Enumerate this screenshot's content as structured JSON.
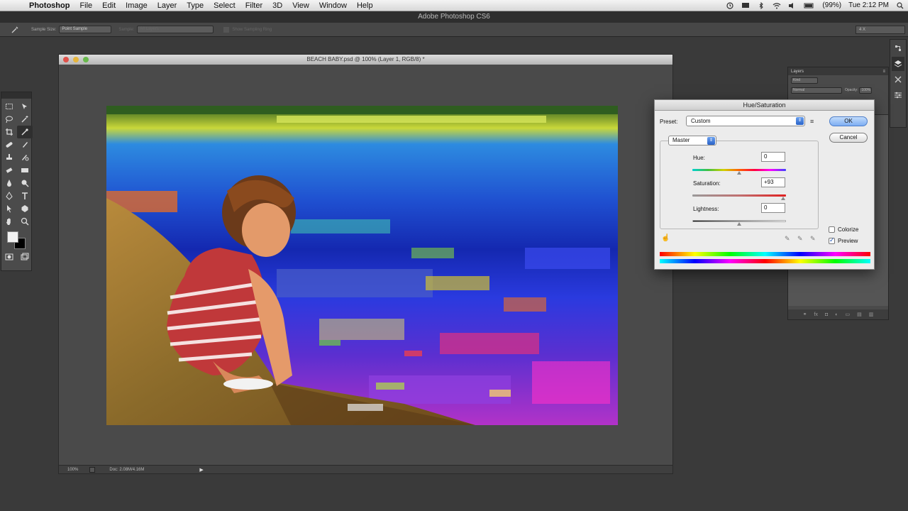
{
  "menubar": {
    "app": "Photoshop",
    "items": [
      "File",
      "Edit",
      "Image",
      "Layer",
      "Type",
      "Select",
      "Filter",
      "3D",
      "View",
      "Window",
      "Help"
    ],
    "clock": "Tue 2:12 PM",
    "battery": "(99%)"
  },
  "app_title": "Adobe Photoshop CS6",
  "options_bar": {
    "sample_size_label": "Sample Size:",
    "sample_size_value": "Point Sample",
    "sample_label": "Sample:",
    "sample_value": "All Layers",
    "show_ring": "Show Sampling Ring",
    "workspace": "4 X"
  },
  "document": {
    "title": "BEACH BABY.psd @ 100% (Layer 1, RGB/8) *",
    "zoom": "100%",
    "doc_info": "Doc: 2.08M/4.16M"
  },
  "layers_panel": {
    "tab": "Layers",
    "kind": "Kind",
    "blend_mode": "Normal",
    "opacity_label": "Opacity:",
    "opacity_value": "100%"
  },
  "dialog": {
    "title": "Hue/Saturation",
    "preset_label": "Preset:",
    "preset_value": "Custom",
    "ok": "OK",
    "cancel": "Cancel",
    "channel": "Master",
    "hue_label": "Hue:",
    "hue_value": "0",
    "saturation_label": "Saturation:",
    "saturation_value": "+93",
    "lightness_label": "Lightness:",
    "lightness_value": "0",
    "colorize_label": "Colorize",
    "colorize_checked": false,
    "preview_label": "Preview",
    "preview_checked": true
  }
}
